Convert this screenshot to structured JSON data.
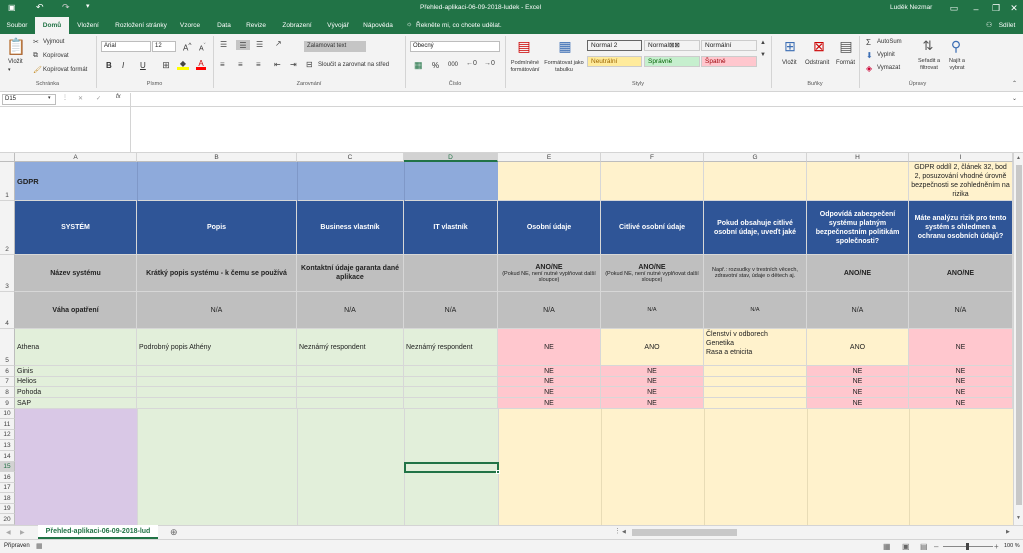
{
  "window": {
    "title": "Přehled-aplikaci-06-09-2018-ludek  -  Excel",
    "user": "Luděk Nezmar",
    "share": "Sdílet"
  },
  "tabs": [
    "Soubor",
    "Domů",
    "Vložení",
    "Rozložení stránky",
    "Vzorce",
    "Data",
    "Revize",
    "Zobrazení",
    "Vývojář",
    "Nápověda"
  ],
  "tell_me": "Řekněte mi, co chcete udělat.",
  "ribbon": {
    "clipboard": {
      "paste": "Vložit",
      "cut": "Vyjmout",
      "copy": "Kopírovat",
      "format_painter": "Kopírovat formát",
      "group": "Schránka"
    },
    "font": {
      "name": "Arial",
      "size": "12",
      "group": "Písmo",
      "bold": "B",
      "italic": "I",
      "underline": "U"
    },
    "alignment": {
      "wrap": "Zalamovat text",
      "merge": "Sloučit a zarovnat na střed",
      "group": "Zarovnání"
    },
    "number": {
      "format": "Obecný",
      "group": "Číslo",
      "percent": "%",
      "thousands": "000"
    },
    "styles": {
      "conditional": "Podmíněné formátování",
      "as_table": "Formátovat jako tabulku",
      "group": "Styly",
      "cells": [
        {
          "label": "Normal 2",
          "bg": "#ffffff",
          "fg": "#000000"
        },
        {
          "label": "Normal⊠⊠",
          "bg": "#ffffff",
          "fg": "#000000"
        },
        {
          "label": "Normální",
          "bg": "#ffffff",
          "fg": "#000000"
        },
        {
          "label": "Neutrální",
          "bg": "#ffeb9c",
          "fg": "#9c6500"
        },
        {
          "label": "Správně",
          "bg": "#c6efce",
          "fg": "#006100"
        },
        {
          "label": "Špatně",
          "bg": "#ffc7ce",
          "fg": "#9c0006"
        }
      ]
    },
    "cells": {
      "insert": "Vložit",
      "delete": "Odstranit",
      "format": "Formát",
      "group": "Buňky"
    },
    "editing": {
      "autosum": "AutoSum",
      "fill": "Vyplnit",
      "clear": "Vymazat",
      "sort": "Seřadit a filtrovat",
      "find": "Najít a vybrat",
      "group": "Úpravy"
    }
  },
  "formula_bar": {
    "name_box": "D15",
    "value": "",
    "fx": "fx"
  },
  "columns": [
    "A",
    "B",
    "C",
    "D",
    "E",
    "F",
    "G",
    "H",
    "I"
  ],
  "rows": {
    "r1": {
      "A": "GDPR",
      "I": "GDPR oddíl 2, článek 32, bod 2, posuzování vhodné úrovně bezpečnosti se zohledněním na rizika"
    },
    "r2": {
      "A": "SYSTÉM",
      "B": "Popis",
      "C": "Business vlastník",
      "D": "IT vlastník",
      "E": "Osobní údaje",
      "F": "Citlivé osobní údaje",
      "G": "Pokud obsahuje citlivé osobní údaje, uveďt jaké",
      "H": "Odpovídá zabezpečení systému platným bezpečnostním politikám společnosti?",
      "I": "Máte analýzu rizik pro tento systém s ohledmen a ochranu osobních údajů?"
    },
    "r3": {
      "A": "Název systému",
      "B": "Krátký popis systému - k čemu se používá",
      "C": "Kontaktní údaje garanta dané aplikace",
      "E": "ANO/NE",
      "E2": "(Pokud NE, není nutné vyplňovat další sloupce)",
      "F": "ANO/NE",
      "F2": "(Pokud NE, není nutné vyplňovat další sloupce)",
      "G": "Např.: rozsudky v trestních věcech, zdravotní stav, údaje o dětech aj.",
      "H": "ANO/NE",
      "I": "ANO/NE"
    },
    "r4": {
      "A": "Váha opatření",
      "B": "N/A",
      "C": "N/A",
      "D": "N/A",
      "E": "N/A",
      "F": "N/A",
      "G": "N/A",
      "H": "N/A",
      "I": "N/A"
    },
    "r5": {
      "A": "Athena",
      "B": "Podrobný popis Athény",
      "C": "Neznámý respondent",
      "D": "Neznámý respondent",
      "E": "NE",
      "F": "ANO",
      "G1": "Členství v odborech",
      "G2": "Genetika",
      "G3": "Rasa a etnicita",
      "H": "ANO",
      "I": "NE"
    },
    "list": [
      {
        "A": "Ginis",
        "E": "NE",
        "F": "NE",
        "H": "NE",
        "I": "NE"
      },
      {
        "A": "Helios",
        "E": "NE",
        "F": "NE",
        "H": "NE",
        "I": "NE"
      },
      {
        "A": "Pohoda",
        "E": "NE",
        "F": "NE",
        "H": "NE",
        "I": "NE"
      },
      {
        "A": "SAP",
        "E": "NE",
        "F": "NE",
        "H": "NE",
        "I": "NE"
      }
    ]
  },
  "row_numbers": [
    "1",
    "2",
    "3",
    "4",
    "5",
    "6",
    "7",
    "8",
    "9",
    "10",
    "11",
    "12",
    "13",
    "14",
    "15",
    "16",
    "17",
    "18",
    "19",
    "20"
  ],
  "sheet_tab": "Přehled-aplikaci-06-09-2018-lud",
  "status": {
    "ready": "Připraven",
    "zoom": "100 %"
  }
}
